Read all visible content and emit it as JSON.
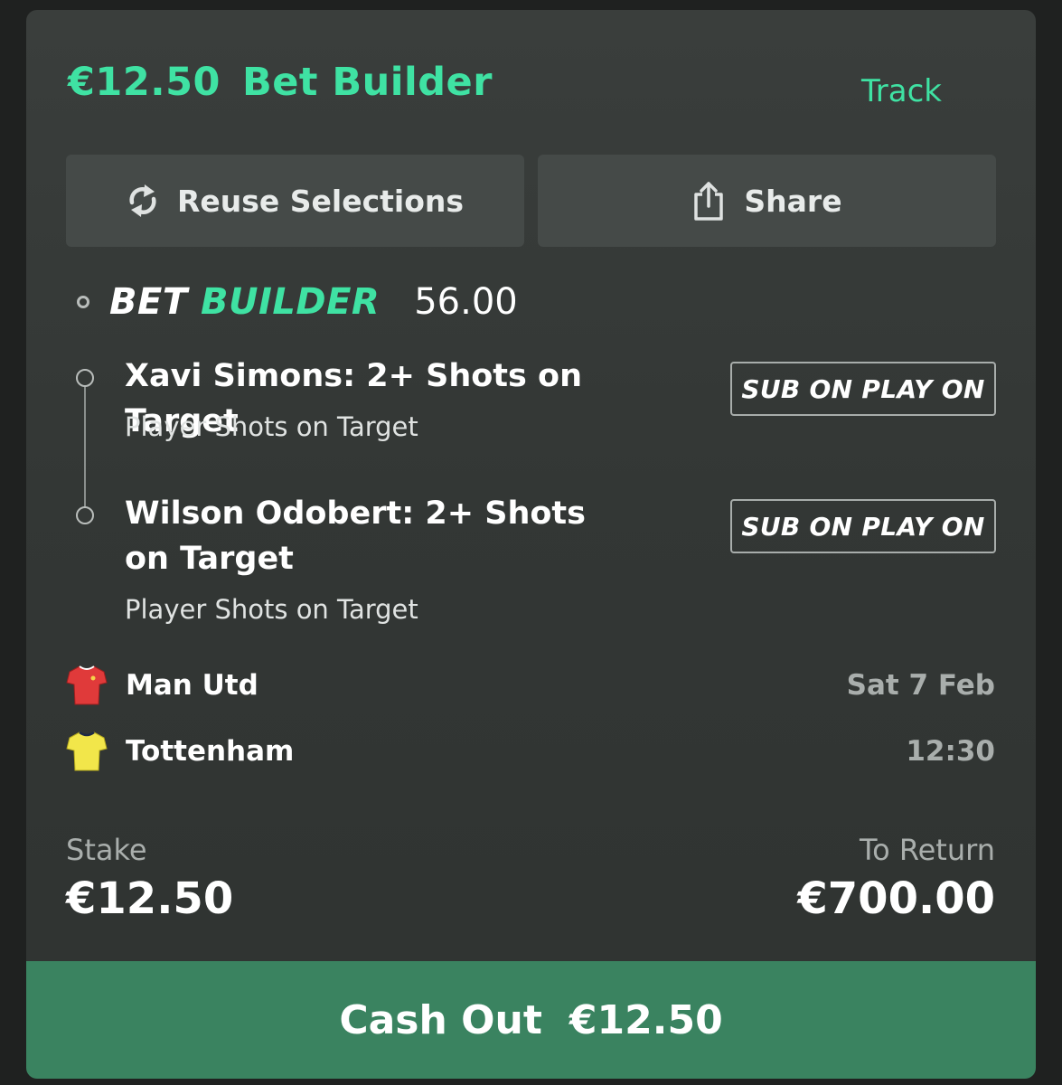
{
  "header": {
    "amount": "€12.50",
    "title": "Bet Builder",
    "track_label": "Track"
  },
  "actions": {
    "reuse_label": "Reuse Selections",
    "share_label": "Share"
  },
  "bet_builder": {
    "logo_word1": "BET",
    "logo_word2": "BUILDER",
    "odds": "56.00",
    "legs": [
      {
        "title": "Xavi Simons: 2+ Shots on Target",
        "market": "Player Shots on Target",
        "badge": "SUB ON PLAY ON"
      },
      {
        "title": "Wilson Odobert: 2+ Shots on Target",
        "market": "Player Shots on Target",
        "badge": "SUB ON PLAY ON"
      }
    ]
  },
  "event": {
    "home": {
      "name": "Man Utd",
      "kit_color": "#e03a3a",
      "kit_icon": "red-shirt-icon"
    },
    "away": {
      "name": "Tottenham",
      "kit_color": "#f2e64a",
      "kit_icon": "yellow-shirt-icon"
    },
    "date": "Sat 7 Feb",
    "time": "12:30"
  },
  "totals": {
    "stake_label": "Stake",
    "stake_value": "€12.50",
    "return_label": "To Return",
    "return_value": "€700.00"
  },
  "cashout": {
    "label": "Cash Out",
    "amount": "€12.50"
  },
  "colors": {
    "accent": "#3fe2a3",
    "cashout_bg": "#3a8360",
    "card_bg": "#353937"
  }
}
